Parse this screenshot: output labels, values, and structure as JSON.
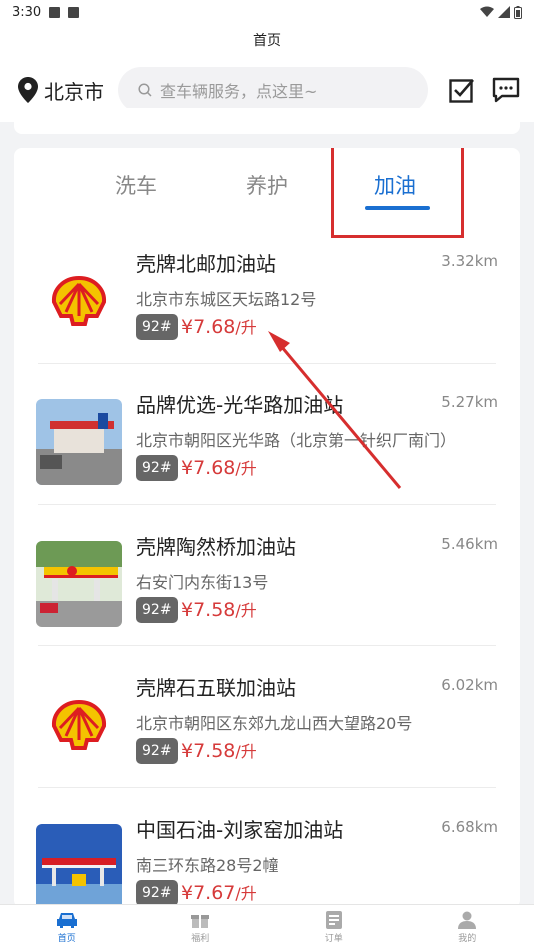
{
  "status": {
    "time": "3:30"
  },
  "app": {
    "title": "首页"
  },
  "header": {
    "city": "北京市",
    "search_placeholder": "查车辆服务，点这里~"
  },
  "tabs": [
    {
      "label": "洗车",
      "active": false
    },
    {
      "label": "养护",
      "active": false
    },
    {
      "label": "加油",
      "active": true
    }
  ],
  "colors": {
    "accent": "#1a6fd1",
    "price": "#d63a3a",
    "highlight": "#d62e2e"
  },
  "stations": [
    {
      "name": "壳牌北邮加油站",
      "distance": "3.32km",
      "address": "北京市东城区天坛路12号",
      "fuel": "92#",
      "price": "¥7.68",
      "unit": "/升",
      "logo": "shell-logo"
    },
    {
      "name": "品牌优选-光华路加油站",
      "distance": "5.27km",
      "address": "北京市朝阳区光华路（北京第一针织厂南门）",
      "fuel": "92#",
      "price": "¥7.68",
      "unit": "/升",
      "logo": "station-photo"
    },
    {
      "name": "壳牌陶然桥加油站",
      "distance": "5.46km",
      "address": "右安门内东街13号",
      "fuel": "92#",
      "price": "¥7.58",
      "unit": "/升",
      "logo": "shell-station-photo"
    },
    {
      "name": "壳牌石五联加油站",
      "distance": "6.02km",
      "address": "北京市朝阳区东郊九龙山西大望路20号",
      "fuel": "92#",
      "price": "¥7.58",
      "unit": "/升",
      "logo": "shell-logo"
    },
    {
      "name": "中国石油-刘家窑加油站",
      "distance": "6.68km",
      "address": "南三环东路28号2幢",
      "fuel": "92#",
      "price": "¥7.67",
      "unit": "/升",
      "logo": "petrochina-station-photo"
    }
  ],
  "bottom_nav": [
    {
      "label": "首页",
      "icon": "car-icon",
      "active": true
    },
    {
      "label": "福利",
      "icon": "gift-icon",
      "active": false
    },
    {
      "label": "订单",
      "icon": "order-icon",
      "active": false
    },
    {
      "label": "我的",
      "icon": "profile-icon",
      "active": false
    }
  ]
}
